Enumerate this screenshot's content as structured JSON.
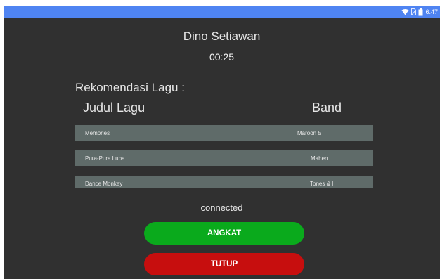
{
  "status_bar": {
    "time": "6:47",
    "icons": [
      "wifi-icon",
      "no-sim-icon",
      "battery-icon"
    ],
    "color": "#4f84f2"
  },
  "call": {
    "caller_name": "Dino Setiawan",
    "duration": "00:25",
    "connection_status": "connected"
  },
  "recommendations": {
    "heading": "Rekomendasi Lagu :",
    "column_title": "Judul Lagu",
    "column_band": "Band",
    "songs": [
      {
        "title": "Memories",
        "band": "Maroon 5"
      },
      {
        "title": "Pura-Pura Lupa",
        "band": "Mahen"
      },
      {
        "title": "Dance Monkey",
        "band": "Tones & I"
      }
    ]
  },
  "actions": {
    "answer_label": "ANGKAT",
    "answer_color": "#0aaa1c",
    "close_label": "TUTUP",
    "close_color": "#c70e0e"
  }
}
